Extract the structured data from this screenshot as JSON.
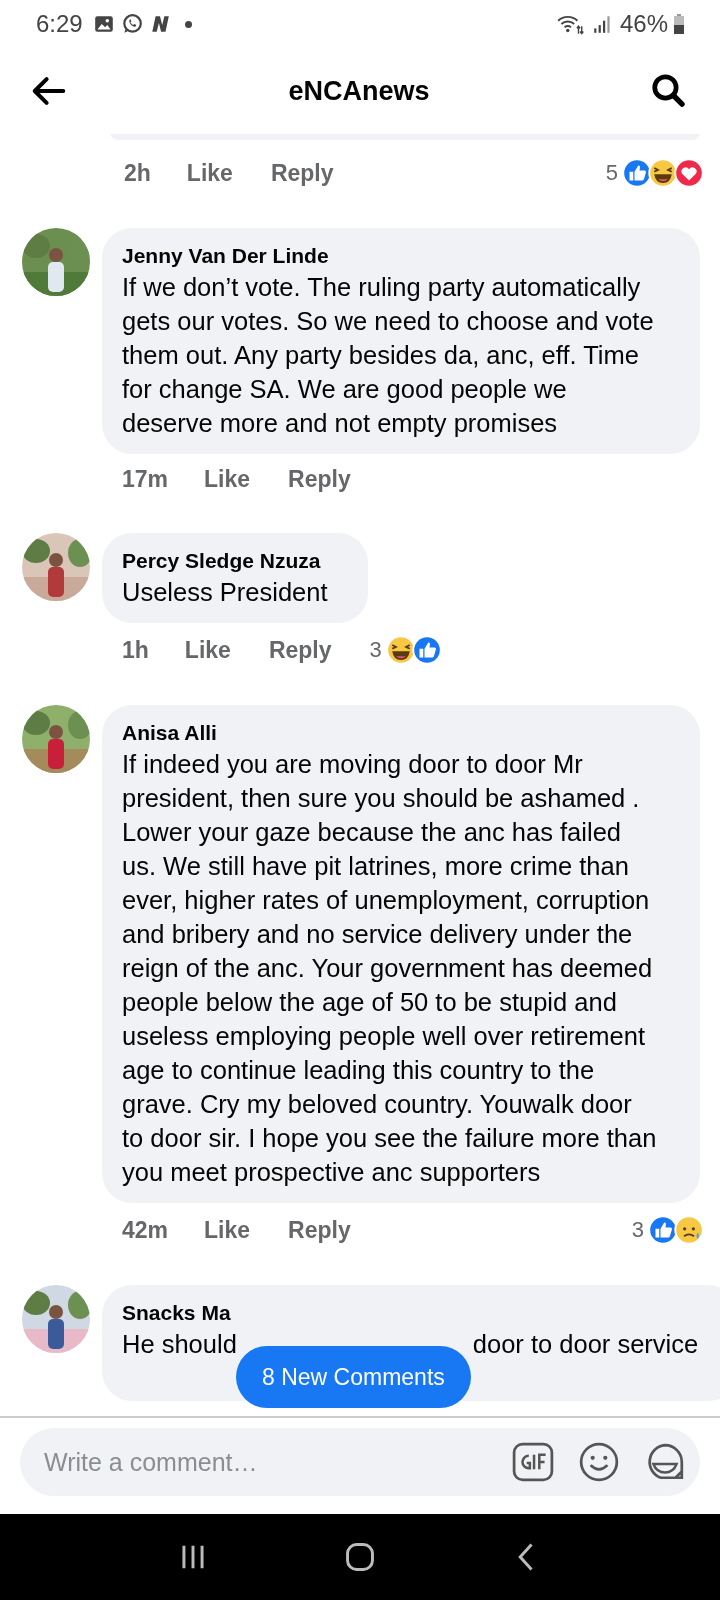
{
  "status_bar": {
    "time": "6:29",
    "battery": "46%"
  },
  "header": {
    "title": "eNCAnews"
  },
  "previous_comment": {
    "time": "2h",
    "like": "Like",
    "reply": "Reply",
    "reaction_count": "5",
    "reactions": [
      {
        "kind": "like"
      },
      {
        "kind": "haha"
      },
      {
        "kind": "love"
      }
    ]
  },
  "comments": [
    {
      "author": "Jenny Van Der Linde",
      "text": "If we don’t vote. The ruling party automatically gets our votes. So we need to choose and vote them out. Any party besides da, anc, eff.  Time for change SA. We are good people we deserve more and not empty promises",
      "time": "17m",
      "like": "Like",
      "reply": "Reply"
    },
    {
      "author": "Percy Sledge Nzuza",
      "text": "Useless President",
      "time": "1h",
      "like": "Like",
      "reply": "Reply",
      "reaction_count": "3",
      "reactions": [
        {
          "kind": "haha"
        },
        {
          "kind": "like"
        }
      ]
    },
    {
      "author": "Anisa Alli",
      "text": "If indeed you are moving door to door Mr president, then sure you should be ashamed . Lower your gaze because the anc has failed us. We still have pit latrines, more crime than ever, higher rates of unemployment, corruption and bribery and no service delivery under the reign of the anc. Your government has deemed people below the age of 50 to be stupid and useless employing people well over retirement age to continue leading this country to the grave. Cry my beloved country. Youwalk door to door sir. I hope you see the failure more than you meet prospective anc supporters",
      "time": "42m",
      "like": "Like",
      "reply": "Reply",
      "reaction_count": "3",
      "reactions": [
        {
          "kind": "like"
        },
        {
          "kind": "sad"
        }
      ]
    }
  ],
  "partial_comment": {
    "author": "Snacks Ma",
    "text_start": "He should",
    "text_end": "door to door service"
  },
  "new_comments_button": "8 New Comments",
  "composer": {
    "placeholder": "Write a comment…"
  }
}
